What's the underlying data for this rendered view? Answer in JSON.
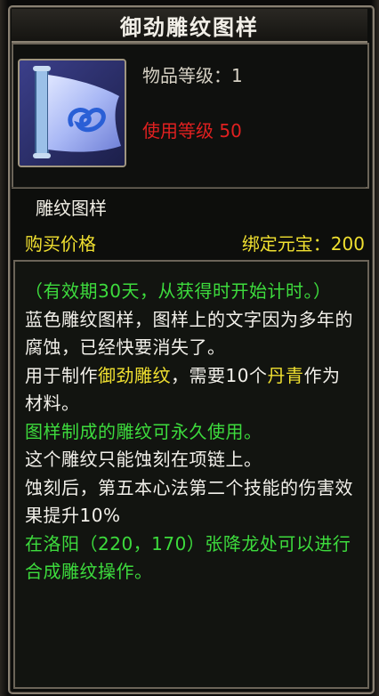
{
  "title": "御劲雕纹图样",
  "item_level": "物品等级：1",
  "use_level": "使用等级 50",
  "category": "雕纹图样",
  "price_label": "购买价格",
  "price_value": "绑定元宝：200",
  "icon": "scroll-icon",
  "colors": {
    "green": "#3ddb3d",
    "white": "#f2f0ea",
    "yellow": "#f0e030",
    "red": "#e02020"
  },
  "description": {
    "validity": "（有效期30天，从获得时开始计时。）",
    "lore": "蓝色雕纹图样，图样上的文字因为多年的腐蚀，已经快要消失了。",
    "usage_prefix": "用于制作",
    "usage_item": "御劲雕纹",
    "usage_mid": "，需要10个",
    "usage_material": "丹青",
    "usage_suffix": "作为材料。",
    "permanent": "图样制成的雕纹可永久使用。",
    "slot": "这个雕纹只能蚀刻在项链上。",
    "effect": "蚀刻后，第五本心法第二个技能的伤害效果提升10%",
    "location": "在洛阳（220，170）张降龙处可以进行合成雕纹操作。"
  }
}
